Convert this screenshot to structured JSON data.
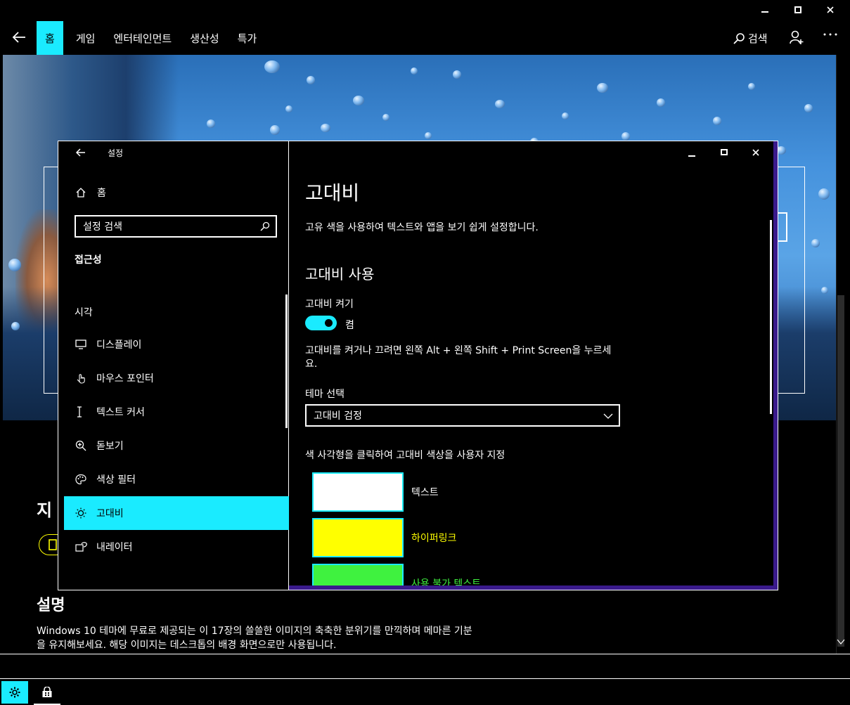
{
  "store": {
    "nav": {
      "home": "홈",
      "games": "게임",
      "entertainment": "엔터테인먼트",
      "productivity": "생산성",
      "deals": "특가",
      "search": "검색"
    },
    "section_title_partial": "지",
    "description_heading": "설명",
    "description_line1": "Windows 10 테마에 무료로 제공되는 이 17장의 쓸쓸한 이미지의 축축한 분위기를 만끽하며 메마른 기분",
    "description_line2": "을 유지해보세요. 해당 이미지는 데스크톱의 배경 화면으로만 사용됩니다."
  },
  "settings": {
    "title": "설정",
    "home": "홈",
    "search_placeholder": "설정 검색",
    "category": "접근성",
    "group": "시각",
    "items": [
      {
        "label": "디스플레이",
        "icon": "monitor-icon"
      },
      {
        "label": "마우스 포인터",
        "icon": "mouse-pointer-icon"
      },
      {
        "label": "텍스트 커서",
        "icon": "text-cursor-icon"
      },
      {
        "label": "돋보기",
        "icon": "magnifier-icon"
      },
      {
        "label": "색상 필터",
        "icon": "palette-icon"
      },
      {
        "label": "고대비",
        "icon": "brightness-icon"
      },
      {
        "label": "내레이터",
        "icon": "narrator-icon"
      }
    ],
    "main": {
      "title": "고대비",
      "subtitle": "고유 색을 사용하여 텍스트와 앱을 보기 쉽게 설정합니다.",
      "section": "고대비 사용",
      "toggle_label": "고대비 켜기",
      "toggle_state": "켬",
      "hint_line1": "고대비를 켜거나 끄려면 왼쪽 Alt + 왼쪽 Shift + Print Screen을 누르세",
      "hint_line2": "요.",
      "theme_label": "테마 선택",
      "theme_value": "고대비 검정",
      "swatch_instruction": "색 사각형을 클릭하여 고대비 색상을 사용자 지정",
      "swatches": [
        {
          "label": "텍스트",
          "color": "#ffffff",
          "label_color": "#ffffff"
        },
        {
          "label": "하이퍼링크",
          "color": "#ffff00",
          "label_color": "#ffff00"
        },
        {
          "label": "사용 불가 텍스트",
          "color": "#3ff23f",
          "label_color": "#3ff23f"
        }
      ]
    }
  },
  "colors": {
    "accent": "#1aebff",
    "frame": "#3a1a8c",
    "hyperlink": "#ffff00",
    "disabled": "#3ff23f"
  }
}
